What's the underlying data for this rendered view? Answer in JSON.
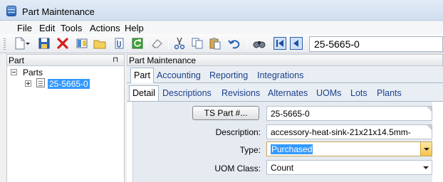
{
  "window": {
    "title": "Part Maintenance"
  },
  "menu": [
    "File",
    "Edit",
    "Tools",
    "Actions",
    "Help"
  ],
  "toolbar": {
    "icons": [
      "new-icon",
      "save-icon",
      "delete-icon",
      "book-icon",
      "folder-icon",
      "attach-icon",
      "refresh-icon",
      "eraser-icon",
      "cut-icon",
      "copy-icon",
      "paste-icon",
      "undo-icon",
      "find-icon",
      "first-record-icon",
      "previous-record-icon"
    ],
    "search_value": "25-5665-0"
  },
  "left_panel": {
    "header": "Part",
    "pin": "⊓",
    "tree": {
      "root": "Parts",
      "child": "25-5665-0"
    }
  },
  "right_panel": {
    "header": "Part Maintenance",
    "tabs": [
      "Part",
      "Accounting",
      "Reporting",
      "Integrations"
    ],
    "subtabs": [
      "Detail",
      "Descriptions",
      "Revisions",
      "Alternates",
      "UOMs",
      "Lots",
      "Plants"
    ],
    "form": {
      "ts_part_button": "TS Part #...",
      "ts_part_value": "25-5665-0",
      "description_label": "Description:",
      "description_value": "accessory-heat-sink-21x21x14.5mm-",
      "type_label": "Type:",
      "type_value": "Purchased",
      "uom_label": "UOM Class:",
      "uom_value": "Count"
    }
  }
}
